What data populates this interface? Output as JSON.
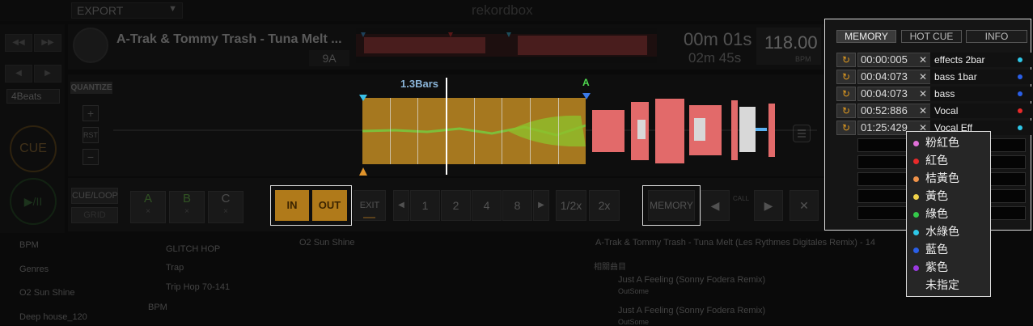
{
  "topbar": {
    "export_label": "EXPORT",
    "logo": "rekordbox"
  },
  "deck": {
    "track_title": "A-Trak & Tommy Trash - Tuna Melt ...",
    "key": "9A",
    "time_main": "00m 01s",
    "time_remain": "02m 45s",
    "bpm": "118.00",
    "bpm_label": "BPM",
    "quantize": "QUANTIZE",
    "rst": "RST",
    "loop_bars": "1.3Bars",
    "marker_a": "A",
    "beats": "4Beats",
    "cue": "CUE"
  },
  "controls": {
    "cue_loop": "CUE/LOOP",
    "grid": "GRID",
    "hot_cues": [
      {
        "label": "A",
        "x": "×"
      },
      {
        "label": "B",
        "x": "×"
      },
      {
        "label": "C",
        "x": "×"
      }
    ],
    "in": "IN",
    "out": "OUT",
    "exit": "EXIT",
    "loop_nums": [
      "1",
      "2",
      "4",
      "8"
    ],
    "half": "1/2x",
    "double": "2x",
    "memory": "MEMORY",
    "call": "CALL",
    "close": "✕"
  },
  "panel": {
    "tabs": [
      "MEMORY",
      "HOT CUE",
      "INFO"
    ],
    "cues": [
      {
        "time": "00:00:005",
        "name": "effects 2bar",
        "color": "#2ec7e8"
      },
      {
        "time": "00:04:073",
        "name": "bass 1bar",
        "color": "#2a5fe8"
      },
      {
        "time": "00:04:073",
        "name": "bass",
        "color": "#2a5fe8"
      },
      {
        "time": "00:52:886",
        "name": "Vocal",
        "color": "#e82a2a"
      },
      {
        "time": "01:25:429",
        "name": "Vocal Eff",
        "color": "#2ec7e8"
      }
    ]
  },
  "color_menu": [
    {
      "label": "粉紅色",
      "color": "#e070d8"
    },
    {
      "label": "紅色",
      "color": "#e82a2a"
    },
    {
      "label": "桔黃色",
      "color": "#f0934a"
    },
    {
      "label": "黃色",
      "color": "#f0d24a"
    },
    {
      "label": "綠色",
      "color": "#34c84a"
    },
    {
      "label": "水綠色",
      "color": "#2ec7e8"
    },
    {
      "label": "藍色",
      "color": "#2a5fe8"
    },
    {
      "label": "紫色",
      "color": "#9a3ae0"
    },
    {
      "label": "未指定",
      "color": ""
    }
  ],
  "browser": {
    "tree": [
      "BPM",
      "Genres",
      "O2 Sun Shine",
      "Deep house_120"
    ],
    "tree2": [
      "GLITCH HOP",
      "Trap",
      "Trip Hop 70-141",
      "BPM"
    ],
    "playlist_title": "O2 Sun Shine",
    "related_title": "A-Trak & Tommy Trash - Tuna Melt (Les Rythmes Digitales Remix) - 14",
    "related_label": "相關曲目",
    "related": [
      {
        "title": "Just A Feeling (Sonny Fodera Remix)",
        "artist": "OutSome"
      },
      {
        "title": "Just A Feeling (Sonny Fodera Remix)",
        "artist": "OutSome"
      }
    ]
  }
}
